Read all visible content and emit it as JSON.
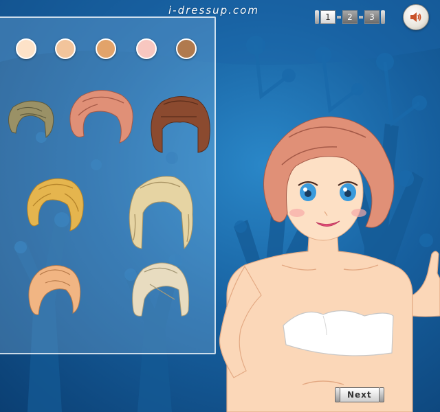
{
  "header": {
    "site_logo": "i-dressup.com"
  },
  "page_indicator": {
    "pages": [
      "1",
      "2",
      "3"
    ],
    "active_page": "1"
  },
  "sound": {
    "icon": "speaker-icon"
  },
  "skin_tones": [
    "#fde2c8",
    "#f2c49b",
    "#e2a36a",
    "#f8c7c0",
    "#b07a4e"
  ],
  "hairstyles": [
    {
      "name": "short-ash-blonde",
      "color": "#9a9166"
    },
    {
      "name": "wavy-pink-bob",
      "color": "#e09077"
    },
    {
      "name": "brown-bob-with-bangs",
      "color": "#8b4a2f"
    },
    {
      "name": "curly-golden-bob",
      "color": "#e5b54e"
    },
    {
      "name": "long-wavy-platinum",
      "color": "#e6d4a3"
    },
    {
      "name": "short-strawberry-blonde",
      "color": "#f1b583"
    },
    {
      "name": "straight-platinum-bob",
      "color": "#e8dcc0"
    }
  ],
  "model": {
    "hair_color": "#e09077",
    "eye_color": "#3a9bdc",
    "top_color": "#ffffff"
  },
  "footer": {
    "next_label": "Next"
  }
}
